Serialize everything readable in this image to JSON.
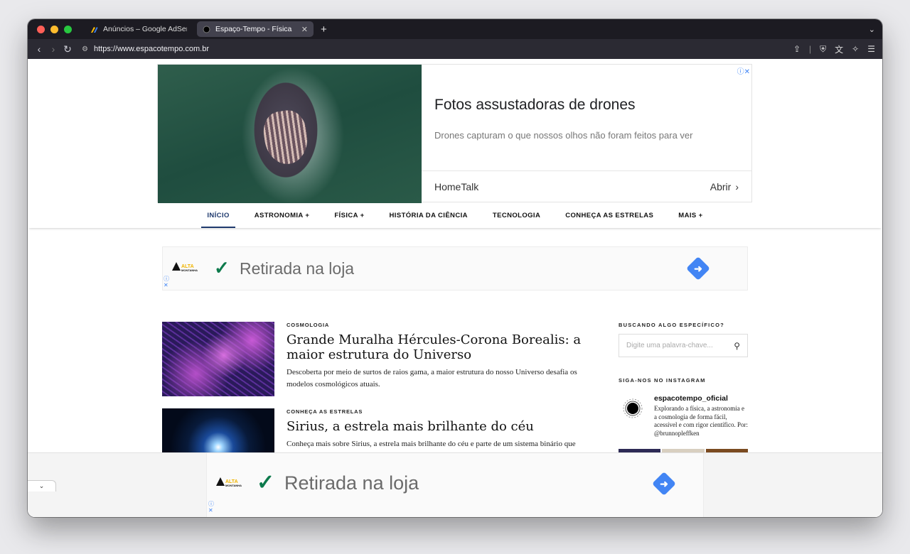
{
  "browser": {
    "tabs": [
      {
        "title": "Anúncios – Google AdSense",
        "active": false
      },
      {
        "title": "Espaço-Tempo - Física e ast",
        "active": true
      }
    ],
    "new_tab": "+",
    "url": "https://www.espacotempo.com.br"
  },
  "top_ad": {
    "title": "Fotos assustadoras de drones",
    "description": "Drones capturam o que nossos olhos não foram feitos para ver",
    "advertiser": "HomeTalk",
    "cta": "Abrir",
    "close": "ⓘ✕"
  },
  "nav": {
    "items": [
      "INÍCIO",
      "ASTRONOMIA +",
      "FÍSICA +",
      "HISTÓRIA DA CIÊNCIA",
      "TECNOLOGIA",
      "CONHEÇA AS ESTRELAS",
      "MAIS +"
    ]
  },
  "strip_ad": {
    "brand_a": "ALTA",
    "brand_b": "MONTANHA",
    "check": "✓",
    "text": "Retirada na loja"
  },
  "articles": [
    {
      "category": "COSMOLOGIA",
      "title": "Grande Muralha Hércules-Corona Borealis: a maior estrutura do Universo",
      "description": "Descoberta por meio de surtos de raios gama, a maior estrutura do nosso Universo desafia os modelos cosmológicos atuais."
    },
    {
      "category": "CONHEÇA AS ESTRELAS",
      "title": "Sirius, a estrela mais brilhante do céu",
      "description": "Conheça mais sobre Sirius, a estrela mais brilhante do céu e parte de um sistema binário que"
    }
  ],
  "sidebar": {
    "search_heading": "BUSCANDO ALGO ESPECÍFICO?",
    "search_placeholder": "Digite uma palavra-chave...",
    "instagram_heading": "SIGA-NOS NO INSTAGRAM",
    "instagram_name": "espacotempo_oficial",
    "instagram_bio": "Explorando a física, a astronomia e a cosmologia de forma fácil, acessível e com rigor científico. Por: @brunnopleffken"
  }
}
